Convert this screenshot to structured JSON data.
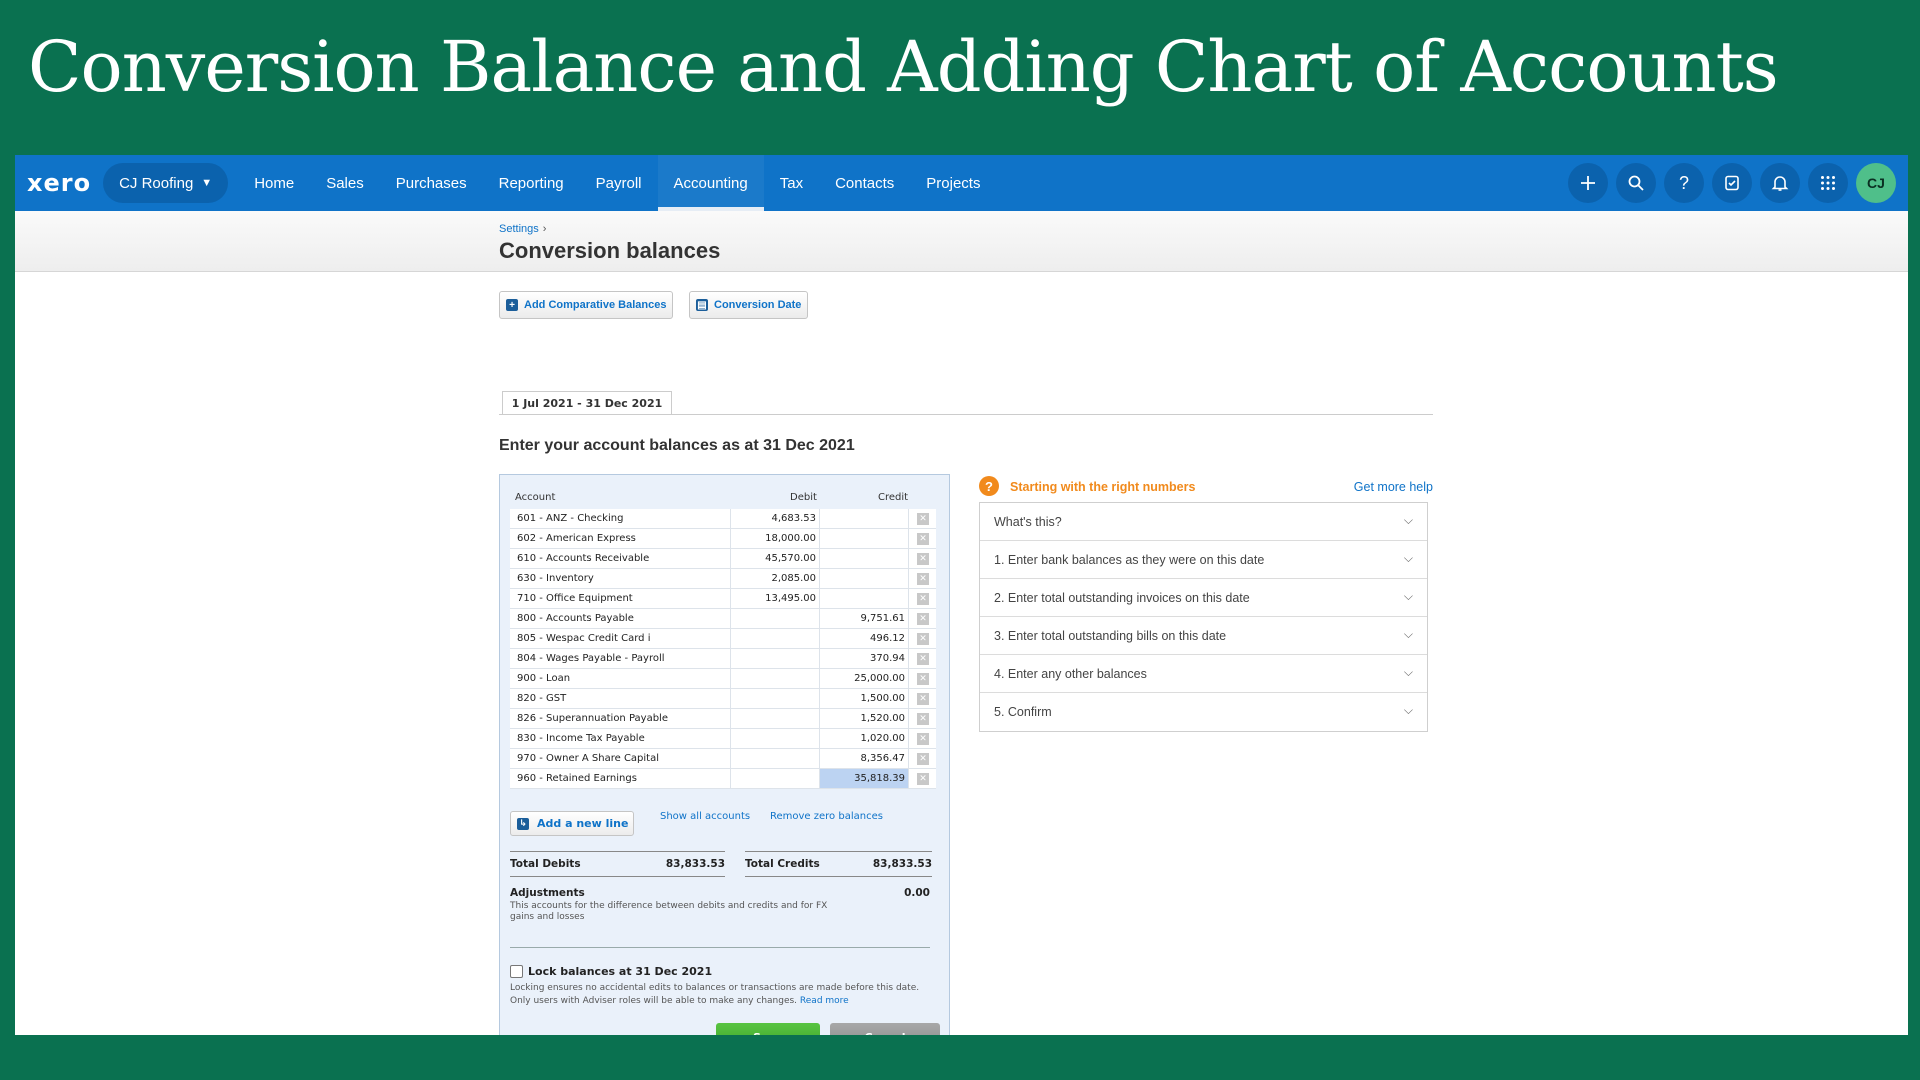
{
  "slide_title": "Conversion Balance and Adding Chart of Accounts",
  "nav": {
    "logo": "xero",
    "org": "CJ Roofing",
    "items": [
      "Home",
      "Sales",
      "Purchases",
      "Reporting",
      "Payroll",
      "Accounting",
      "Tax",
      "Contacts",
      "Projects"
    ],
    "active": "Accounting",
    "icons": [
      "plus-icon",
      "search-icon",
      "help-icon",
      "checklist-icon",
      "bell-icon",
      "apps-grid-icon"
    ],
    "avatar": "CJ"
  },
  "breadcrumb": "Settings",
  "page_title": "Conversion balances",
  "buttons": {
    "add_comparative": "Add Comparative Balances",
    "conversion_date": "Conversion Date",
    "add_line": "Add a new line",
    "save": "Save",
    "cancel": "Cancel"
  },
  "period_tab": "1 Jul 2021 - 31 Dec 2021",
  "subheading": "Enter your account balances as at 31 Dec 2021",
  "table": {
    "headers": {
      "account": "Account",
      "debit": "Debit",
      "credit": "Credit"
    },
    "rows": [
      {
        "account": "601 - ANZ - Checking",
        "debit": "4,683.53",
        "credit": ""
      },
      {
        "account": "602 - American Express",
        "debit": "18,000.00",
        "credit": ""
      },
      {
        "account": "610 - Accounts Receivable",
        "debit": "45,570.00",
        "credit": ""
      },
      {
        "account": "630 - Inventory",
        "debit": "2,085.00",
        "credit": ""
      },
      {
        "account": "710 - Office Equipment",
        "debit": "13,495.00",
        "credit": ""
      },
      {
        "account": "800 - Accounts Payable",
        "debit": "",
        "credit": "9,751.61"
      },
      {
        "account": "805 - Wespac Credit Card i",
        "debit": "",
        "credit": "496.12"
      },
      {
        "account": "804 - Wages Payable - Payroll",
        "debit": "",
        "credit": "370.94"
      },
      {
        "account": "900 - Loan",
        "debit": "",
        "credit": "25,000.00"
      },
      {
        "account": "820 - GST",
        "debit": "",
        "credit": "1,500.00"
      },
      {
        "account": "826 - Superannuation Payable",
        "debit": "",
        "credit": "1,520.00"
      },
      {
        "account": "830 - Income Tax Payable",
        "debit": "",
        "credit": "1,020.00"
      },
      {
        "account": "970 - Owner A Share Capital",
        "debit": "",
        "credit": "8,356.47"
      },
      {
        "account": "960 - Retained Earnings",
        "debit": "",
        "credit": "35,818.39"
      }
    ]
  },
  "links": {
    "show_all": "Show all accounts",
    "remove_zero": "Remove zero balances",
    "read_more": "Read more"
  },
  "totals": {
    "debits_label": "Total Debits",
    "debits_value": "83,833.53",
    "credits_label": "Total Credits",
    "credits_value": "83,833.53"
  },
  "adjustments": {
    "label": "Adjustments",
    "value": "0.00",
    "description": "This accounts for the difference between debits and credits and for FX gains and losses"
  },
  "lock": {
    "label": "Lock balances at 31 Dec 2021",
    "checked": false,
    "description": "Locking ensures no accidental edits to balances or transactions are made before this date. Only users with Adviser roles will be able to make any changes."
  },
  "help": {
    "title": "Starting with the right numbers",
    "more": "Get more help",
    "items": [
      "What's this?",
      "1. Enter bank balances as they were on this date",
      "2. Enter total outstanding invoices on this date",
      "3. Enter total outstanding bills on this date",
      "4. Enter any other balances",
      "5. Confirm"
    ]
  }
}
